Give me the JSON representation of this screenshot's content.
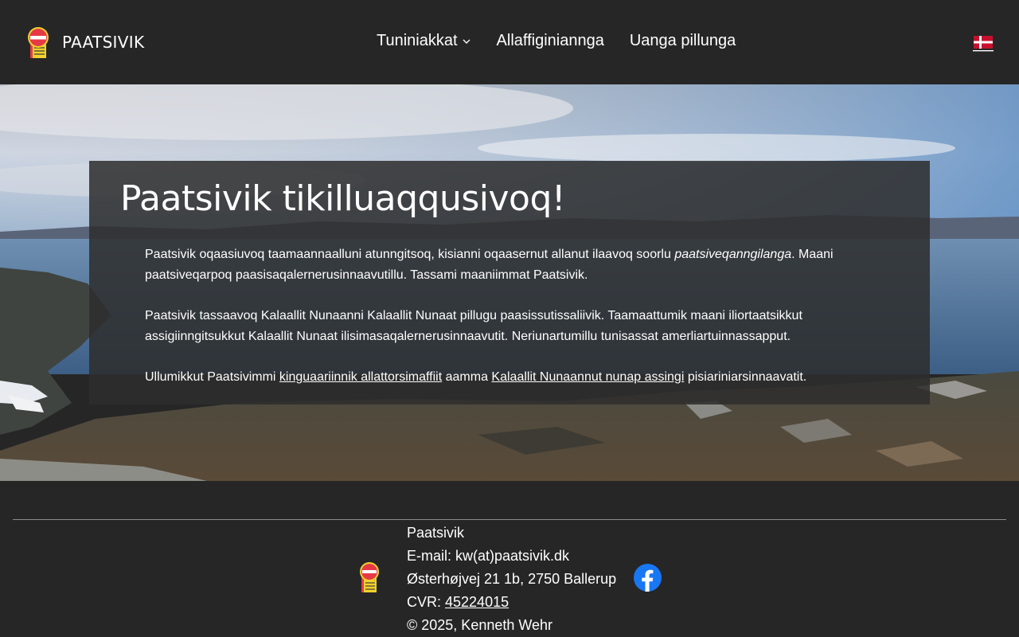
{
  "header": {
    "brand_name": "PAATSIVIK",
    "nav": [
      {
        "label": "Tuniniakkat",
        "has_dropdown": true
      },
      {
        "label": "Allaffiginiannga"
      },
      {
        "label": "Uanga pillunga"
      }
    ],
    "language_icon": "danish-flag-icon"
  },
  "hero": {
    "title": "Paatsivik tikilluaqqusivoq!",
    "p1_text": "Paatsivik oqaasiuvoq taamaannaalluni atunngitsoq, kisianni oqaasernut allanut ilaavoq soorlu ",
    "p1_italic": "paatsiveqanngilanga",
    "p1_after": ". Maani paatsiveqarpoq paasisaqalernerusinnaavutillu. Tassami maaniimmat Paatsivik.",
    "p2_text": "Paatsivik tassaavoq Kalaallit Nunaanni Kalaallit Nunaat pillugu paasissutissaliivik. Taamaattumik maani iliortaatsikkut assigiinngitsukkut Kalaallit Nunaat ilisimasaqalernerusinnaavutit. Neriunartumillu tunisassat amerliartuinnassapput.",
    "p3_before": "Ullumikkut Paatsivimmi ",
    "p3_link1": "kinguaariinnik allattorsimaffiit",
    "p3_middle": " aamma ",
    "p3_link2": "Kalaallit Nunaannut nunap assingi",
    "p3_after": " pisiariniarsinnaavatit."
  },
  "footer": {
    "name": "Paatsivik",
    "email": "E-mail: kw(at)paatsivik.dk",
    "address": "Østerhøjvej 21 1b, 2750 Ballerup",
    "cvr_label": "CVR: ",
    "cvr_number": "45224015",
    "copyright": "© 2025, Kenneth Wehr",
    "social_icon": "facebook-icon"
  },
  "colors": {
    "background": "#262626",
    "text": "#ffffff",
    "card": "#2d2d2d",
    "facebook": "#1877f2",
    "logo_red": "#e63946",
    "logo_yellow": "#f2d22e"
  }
}
